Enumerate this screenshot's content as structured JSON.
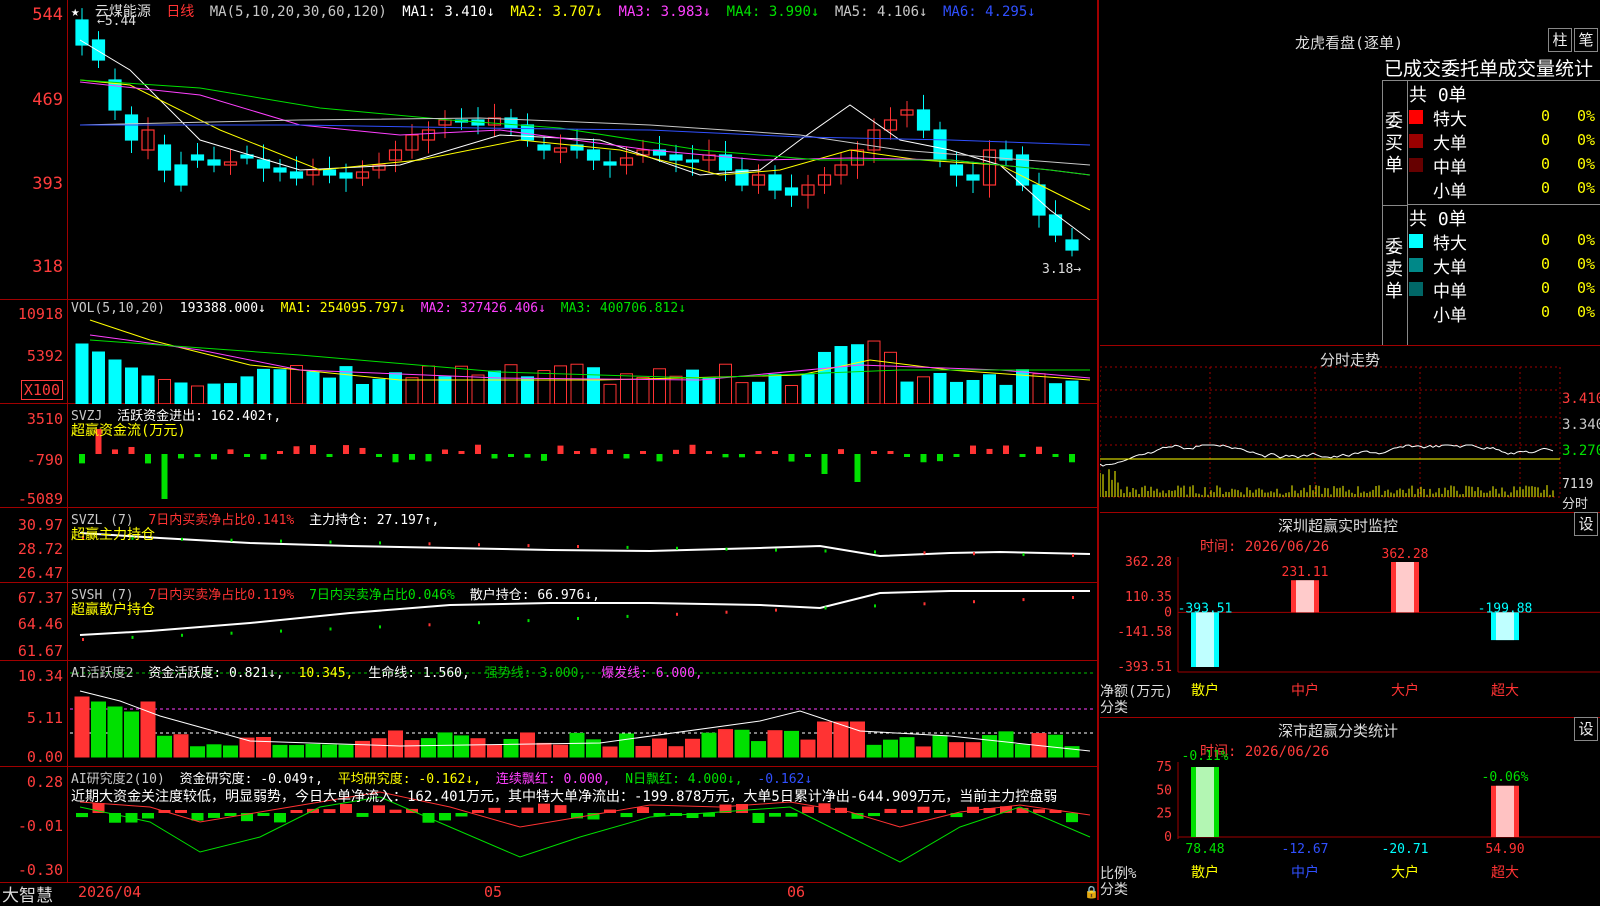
{
  "stock": {
    "name": "云煤能源",
    "period": "日线"
  },
  "colors": {
    "up": "#ff3333",
    "down": "#00ffff",
    "green": "#00e000",
    "yellow": "#ffff00",
    "magenta": "#ff40ff",
    "white": "#ffffff",
    "blue": "#3050ff",
    "axis": "#ff3c3c",
    "frame": "#a00000"
  },
  "price_pane": {
    "ma_label": "MA(5,10,20,30,60,120)",
    "ma": [
      {
        "label": "MA1: 3.410↓",
        "color": "#ffffff"
      },
      {
        "label": "MA2: 3.707↓",
        "color": "#ffff00"
      },
      {
        "label": "MA3: 3.983↓",
        "color": "#ff40ff"
      },
      {
        "label": "MA4: 3.990↓",
        "color": "#00e000"
      },
      {
        "label": "MA5: 4.106↓",
        "color": "#c8c8c8"
      },
      {
        "label": "MA6: 4.295↓",
        "color": "#3050ff"
      }
    ],
    "yticks": [
      "544",
      "469",
      "393",
      "318"
    ],
    "high_label": "5.44",
    "low_label": "3.18"
  },
  "volume_pane": {
    "title": "VOL(5,10,20)",
    "value": "193388.000↓",
    "ma": [
      {
        "label": "MA1: 254095.797↓",
        "color": "#ffff00"
      },
      {
        "label": "MA2: 327426.406↓",
        "color": "#ff40ff"
      },
      {
        "label": "MA3: 400706.812↓",
        "color": "#00e000"
      }
    ],
    "yticks": [
      "10918",
      "5392"
    ],
    "unit": "X100"
  },
  "svzj_pane": {
    "title": "SVZJ",
    "label": "活跃资金进出: 162.402↑,",
    "sub": "超赢资金流(万元)",
    "yticks": [
      "3510",
      "-790",
      "-5089"
    ]
  },
  "svzl_pane": {
    "title": "SVZL (7)",
    "label1": "7日内买卖净占比0.141%",
    "label2": "主力持仓: 27.197↑,",
    "sub": "超赢主力持仓",
    "yticks": [
      "30.97",
      "28.72",
      "26.47"
    ]
  },
  "svsh_pane": {
    "title": "SVSH (7)",
    "label1": "7日内买卖净占比0.119%",
    "label2": "7日内买卖净占比0.046%",
    "label3": "散户持仓: 66.976↓,",
    "sub": "超赢散户持仓",
    "yticks": [
      "67.37",
      "64.46",
      "61.67"
    ]
  },
  "ai_active_pane": {
    "title": "AI活跃度2",
    "label1": "资金活跃度: 0.821↓,",
    "label2": "10.345,",
    "label3": "生命线: 1.560,",
    "label4": "强势线: 3.000,",
    "label5": "爆发线: 6.000,",
    "yticks": [
      "10.34",
      "5.11",
      "0.00"
    ]
  },
  "ai_research_pane": {
    "title": "AI研究度2(10)",
    "label1": "资金研究度: -0.049↑,",
    "label2": "平均研究度: -0.162↓,",
    "label3": "连续飘红: 0.000,",
    "label4": "N日飘红: 4.000↓,",
    "label5": "-0.162↓",
    "yticks": [
      "0.28",
      "-0.01",
      "-0.30"
    ],
    "comment": "近期大资金关注度较低，明显弱势，今日大单净流入：162.401万元，其中特大单净流出：-199.878万元，大单5日累计净出-644.909万元，当前主力控盘弱"
  },
  "xaxis": {
    "labels": [
      "2026/04",
      "05",
      "06"
    ]
  },
  "brand": "大智慧",
  "order_book": {
    "title": "龙虎看盘(逐单)",
    "btn_zhu": "柱",
    "btn_bi": "笔",
    "tabs": [
      "已成交",
      "委托单",
      "成交量统计"
    ],
    "buy": {
      "side": "委买单",
      "total": "共 0单",
      "rows": [
        {
          "label": "特大",
          "val": "0",
          "pct": "0%",
          "color": "#ff0000"
        },
        {
          "label": "大单",
          "val": "0",
          "pct": "0%",
          "color": "#990000"
        },
        {
          "label": "中单",
          "val": "0",
          "pct": "0%",
          "color": "#660000"
        },
        {
          "label": "小单",
          "val": "0",
          "pct": "0%",
          "color": "#000000"
        }
      ]
    },
    "sell": {
      "side": "委卖单",
      "total": "共 0单",
      "rows": [
        {
          "label": "特大",
          "val": "0",
          "pct": "0%",
          "color": "#00ffff"
        },
        {
          "label": "大单",
          "val": "0",
          "pct": "0%",
          "color": "#008888"
        },
        {
          "label": "中单",
          "val": "0",
          "pct": "0%",
          "color": "#006666"
        },
        {
          "label": "小单",
          "val": "0",
          "pct": "0%",
          "color": "#000000"
        }
      ]
    }
  },
  "intraday": {
    "title": "分时走势",
    "yticks": [
      "3.410",
      "3.340",
      "3.270"
    ],
    "vol_label": "7119",
    "vol_unit": "分时"
  },
  "sz_monitor": {
    "title": "深圳超赢实时监控",
    "btn": "设",
    "time": "时间: 2026/06/26",
    "yticks": [
      "362.28",
      "110.35",
      "0",
      "-141.58",
      "-393.51"
    ],
    "ylabel": "净额(万元)",
    "xlabel": "分类",
    "categories": [
      "散户",
      "中户",
      "大户",
      "超大"
    ],
    "values": [
      -393.51,
      231.11,
      362.28,
      -199.88
    ],
    "value_labels": [
      "-393.51",
      "231.11",
      "362.28",
      "-199.88"
    ]
  },
  "sz_stats": {
    "title": "深市超赢分类统计",
    "btn": "设",
    "time": "时间: 2026/06/26",
    "yticks": [
      "75",
      "50",
      "25",
      "0"
    ],
    "ylabel": "比例%",
    "xlabel": "分类",
    "categories": [
      "散户",
      "中户",
      "大户",
      "超大"
    ],
    "values": [
      78.48,
      -12.67,
      -20.71,
      54.9
    ],
    "value_labels": [
      "78.48",
      "-12.67",
      "-20.71",
      "54.90"
    ],
    "pct_labels": [
      "-0.11%",
      "-0.06%"
    ]
  }
}
